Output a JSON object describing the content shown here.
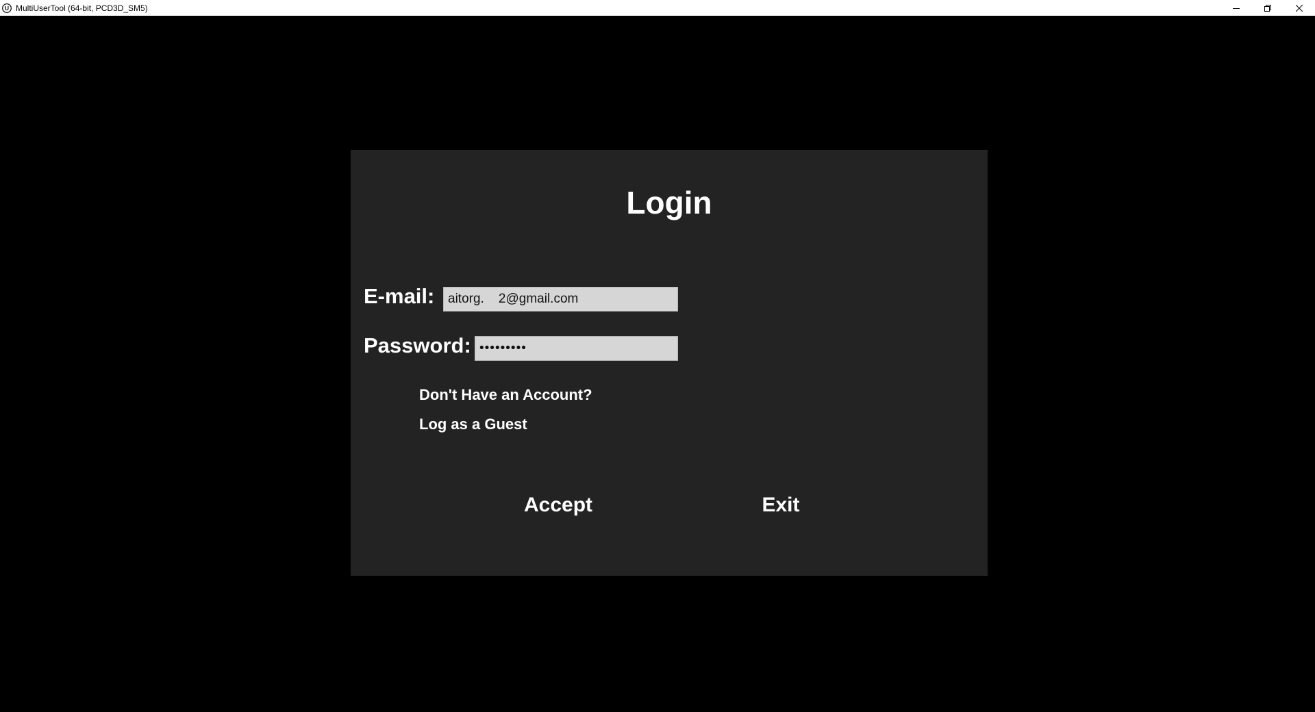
{
  "window": {
    "title": "MultiUserTool (64-bit, PCD3D_SM5)",
    "icon": "unreal-engine-icon",
    "controls": [
      "minimize-icon",
      "restore-icon",
      "close-icon"
    ]
  },
  "login": {
    "title": "Login",
    "email_label": "E-mail:",
    "email_value": "aitorg.    2@gmail.com",
    "password_label": "Password:",
    "password_value": "•••••••••",
    "no_account_link": "Don't Have an Account?",
    "guest_link": "Log as a Guest",
    "accept_button": "Accept",
    "exit_button": "Exit"
  },
  "colors": {
    "background": "#000000",
    "panel": "#232323",
    "field": "#d6d6d6",
    "text": "#ffffff"
  }
}
